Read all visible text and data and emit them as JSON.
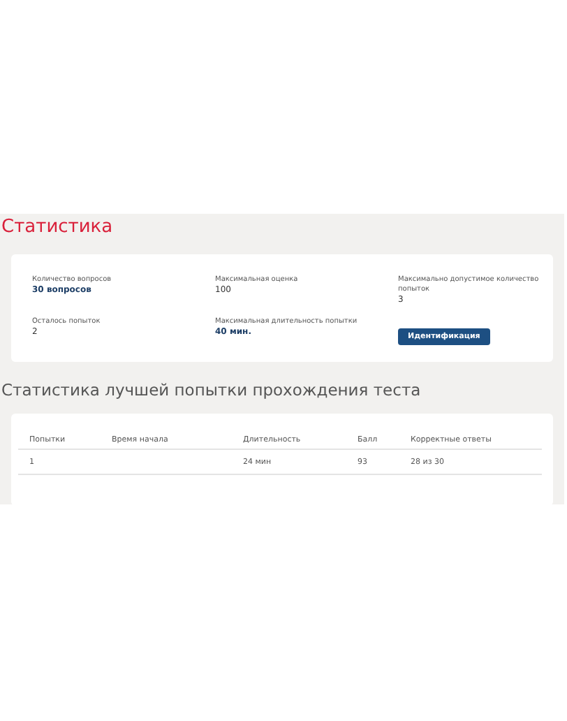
{
  "title": "Статистика",
  "info": [
    {
      "label": "Количество вопросов",
      "value": "30 вопросов",
      "bold": true
    },
    {
      "label": "Максимальная оценка",
      "value": "100",
      "bold": false
    },
    {
      "label": "Максимально допустимое количество попыток",
      "value": "3",
      "bold": false
    },
    {
      "label": "Осталось попыток",
      "value": "2",
      "bold": false
    },
    {
      "label": "Максимальная длительность попытки",
      "value": "40 мин.",
      "bold": true
    }
  ],
  "button": "Идентификация",
  "best_title": "Статистика лучшей попытки прохождения теста",
  "table": {
    "columns": [
      "Попытки",
      "Время начала",
      "Длительность",
      "Балл",
      "Корректные ответы"
    ],
    "rows": [
      [
        "1",
        "",
        "24 мин",
        "93",
        "28 из 30"
      ]
    ]
  }
}
